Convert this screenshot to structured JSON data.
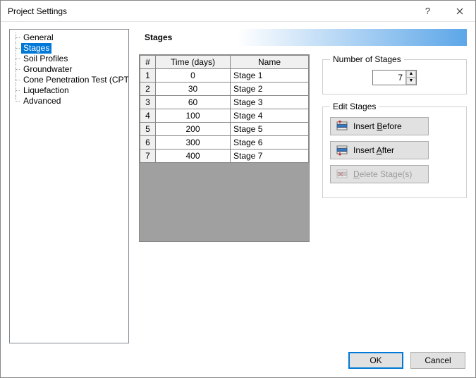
{
  "window": {
    "title": "Project Settings"
  },
  "nav": {
    "items": [
      {
        "label": "General"
      },
      {
        "label": "Stages",
        "selected": true
      },
      {
        "label": "Soil Profiles"
      },
      {
        "label": "Groundwater"
      },
      {
        "label": "Cone Penetration Test (CPT)"
      },
      {
        "label": "Liquefaction"
      },
      {
        "label": "Advanced"
      }
    ]
  },
  "section": {
    "title": "Stages"
  },
  "table": {
    "headers": {
      "index": "#",
      "time": "Time (days)",
      "name": "Name"
    },
    "rows": [
      {
        "idx": "1",
        "time": "0",
        "name": "Stage 1"
      },
      {
        "idx": "2",
        "time": "30",
        "name": "Stage 2"
      },
      {
        "idx": "3",
        "time": "60",
        "name": "Stage 3"
      },
      {
        "idx": "4",
        "time": "100",
        "name": "Stage 4"
      },
      {
        "idx": "5",
        "time": "200",
        "name": "Stage 5"
      },
      {
        "idx": "6",
        "time": "300",
        "name": "Stage 6"
      },
      {
        "idx": "7",
        "time": "400",
        "name": "Stage 7"
      }
    ]
  },
  "numStages": {
    "legend": "Number of Stages",
    "value": "7"
  },
  "editStages": {
    "legend": "Edit Stages",
    "insertBefore": {
      "pre": "Insert ",
      "u": "B",
      "post": "efore"
    },
    "insertAfter": {
      "pre": "Insert ",
      "u": "A",
      "post": "fter"
    },
    "deleteStages": {
      "u": "D",
      "post": "elete Stage(s)"
    }
  },
  "footer": {
    "ok": "OK",
    "cancel": "Cancel"
  }
}
